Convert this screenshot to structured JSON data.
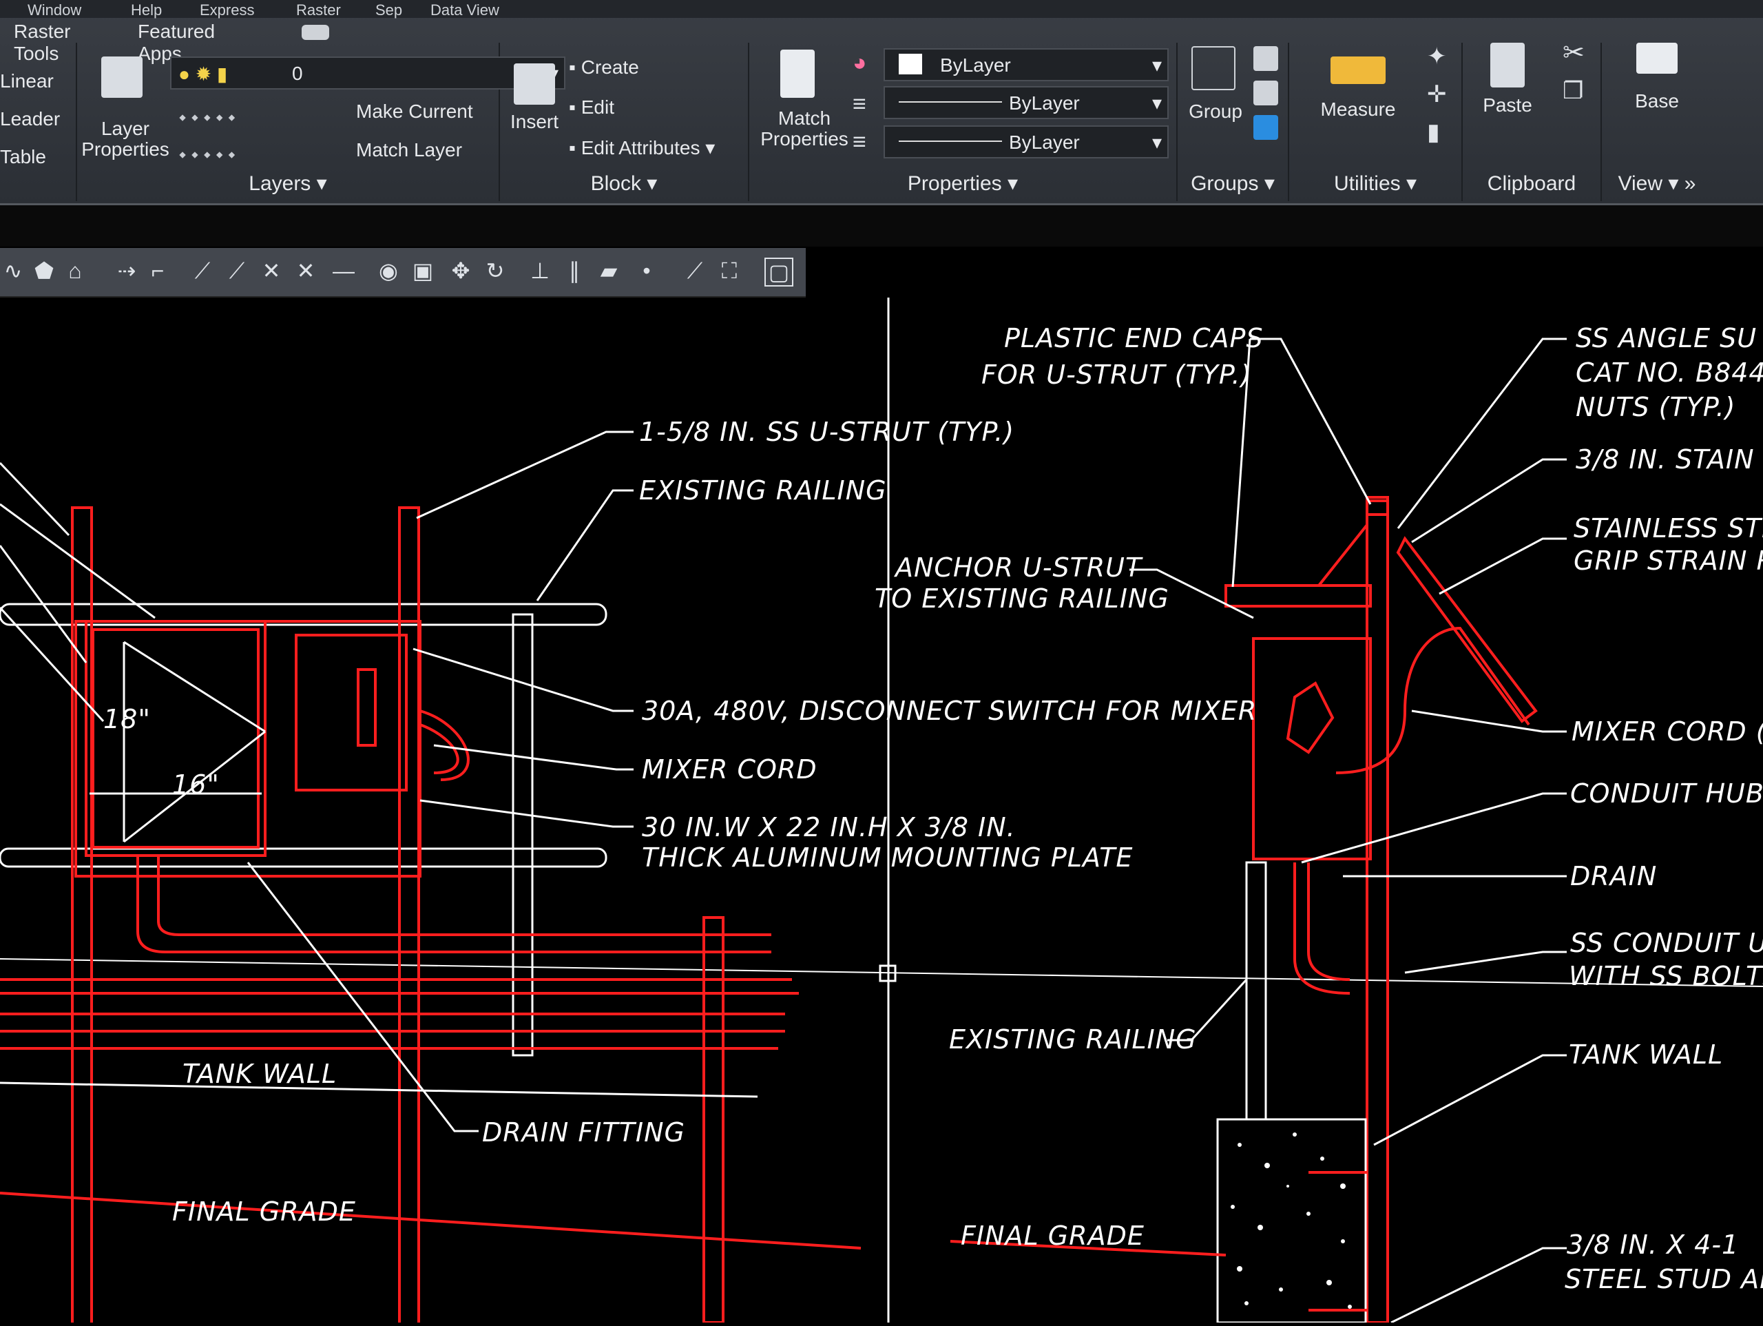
{
  "top_menu": [
    "Window",
    "Help",
    "Express",
    "Raster",
    "Sep",
    "Data View"
  ],
  "subtabs": {
    "raster_tools": "Raster Tools",
    "featured_apps": "Featured Apps"
  },
  "ribbon": {
    "annotation": {
      "linear": "Linear",
      "leader": "Leader",
      "table": "Table"
    },
    "layers": {
      "label": "Layers",
      "layer_properties": "Layer Properties",
      "layer_dropdown": "0",
      "make_current": "Make Current",
      "match_layer": "Match Layer"
    },
    "block": {
      "label": "Block",
      "insert": "Insert",
      "create": "Create",
      "edit": "Edit",
      "edit_attributes": "Edit Attributes"
    },
    "properties": {
      "label": "Properties",
      "match_properties": "Match Properties",
      "color": "ByLayer",
      "linetype": "ByLayer",
      "lineweight": "ByLayer"
    },
    "groups": {
      "label": "Groups",
      "group": "Group"
    },
    "utilities": {
      "label": "Utilities",
      "measure": "Measure"
    },
    "clipboard": {
      "label": "Clipboard",
      "paste": "Paste"
    },
    "view": {
      "label": "View",
      "base": "Base"
    }
  },
  "drawing": {
    "annotations": {
      "u_strut": "1-5/8 IN. SS U-STRUT (TYP.)",
      "existing_railing_top": "EXISTING RAILING",
      "disconnect": "30A, 480V, DISCONNECT SWITCH FOR MIXER",
      "mixer_cord": "MIXER CORD",
      "plate_1": "30 IN.W X 22 IN.H X 3/8 IN.",
      "plate_2": "THICK ALUMINUM MOUNTING PLATE",
      "dim_18": "18\"",
      "dim_16": "16\"",
      "tank_wall_left": "TANK WALL",
      "drain_fitting": "DRAIN FITTING",
      "final_grade_left": "FINAL GRADE",
      "end_caps_1": "PLASTIC END CAPS",
      "end_caps_2": "FOR U-STRUT (TYP.)",
      "anchor_1": "ANCHOR U-STRUT",
      "anchor_2": "TO EXISTING RAILING",
      "existing_railing_right": "EXISTING RAILING",
      "final_grade_right": "FINAL GRADE",
      "ss_angle_1": "SS ANGLE SU",
      "ss_angle_2": "CAT NO. B844",
      "ss_angle_3": "NUTS (TYP.)",
      "stain": "3/8 IN. STAIN",
      "stainless_1": "STAINLESS STE",
      "stainless_2": "GRIP STRAIN R",
      "mixer_cord_right": "MIXER CORD (",
      "conduit_hub": "CONDUIT HUB",
      "drain": "DRAIN",
      "ss_conduit_1": "SS CONDUIT U-",
      "ss_conduit_2": "WITH SS BOLTS",
      "tank_wall_right": "TANK WALL",
      "stud_1": "3/8 IN. X 4-1",
      "stud_2": "STEEL STUD AN"
    }
  },
  "colors": {
    "ribbon": "#33373d",
    "canvas": "#000000",
    "geometry_red": "#ff1e1e",
    "annotation_white": "#ffffff"
  }
}
